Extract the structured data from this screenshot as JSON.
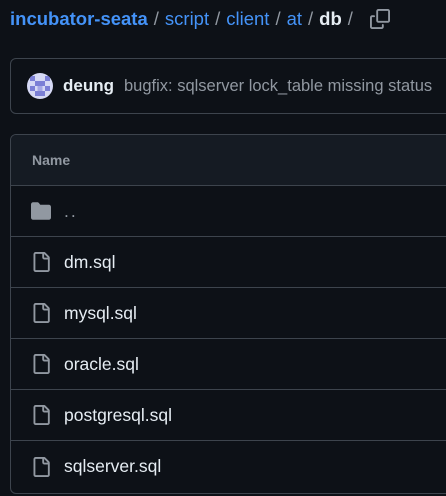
{
  "breadcrumb": {
    "repo": "incubator-seata",
    "segments": [
      "script",
      "client",
      "at"
    ],
    "current": "db",
    "separator": "/",
    "copy_icon": "copy-icon"
  },
  "commit": {
    "author": "deung",
    "message": "bugfix: sqlserver lock_table missing status"
  },
  "table": {
    "header": "Name",
    "parent_dir": "..",
    "files": [
      "dm.sql",
      "mysql.sql",
      "oracle.sql",
      "postgresql.sql",
      "sqlserver.sql"
    ]
  },
  "colors": {
    "background": "#0d1117",
    "link": "#4493f8",
    "border": "#3d444d",
    "muted": "#9198a1",
    "text": "#e6edf3"
  }
}
